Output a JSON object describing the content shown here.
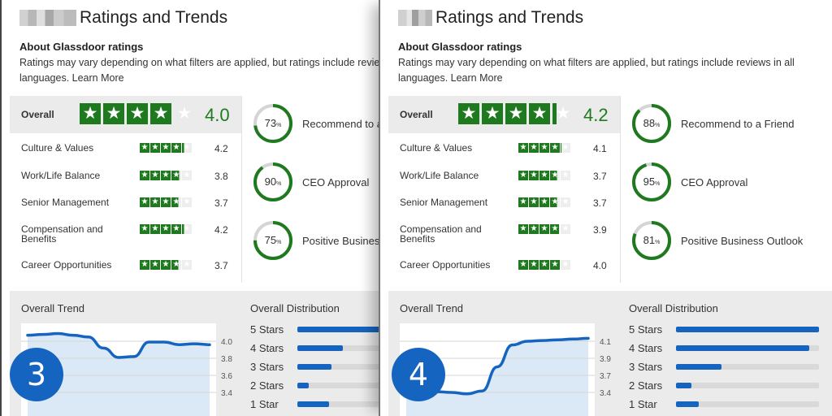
{
  "panels": [
    {
      "id": "left",
      "title": "Ratings and Trends",
      "about_title": "About Glassdoor ratings",
      "about_text": "Ratings may vary depending on what filters are applied, but ratings include reviews in all languages.",
      "learn_more": "Learn More",
      "overall": {
        "label": "Overall",
        "value": "4.0",
        "stars": 4.0
      },
      "subratings": [
        {
          "label": "Culture & Values",
          "value": "4.2",
          "stars": 4.2
        },
        {
          "label": "Work/Life Balance",
          "value": "3.8",
          "stars": 3.8
        },
        {
          "label": "Senior Management",
          "value": "3.7",
          "stars": 3.7
        },
        {
          "label": "Compensation and Benefits",
          "value": "4.2",
          "stars": 4.2
        },
        {
          "label": "Career Opportunities",
          "value": "3.7",
          "stars": 3.7
        }
      ],
      "recommendations": [
        {
          "label": "Recommend to a Friend",
          "percent": 73
        },
        {
          "label": "CEO Approval",
          "percent": 90
        },
        {
          "label": "Positive Business Outlook",
          "percent": 75
        }
      ],
      "trend": {
        "title": "Overall Trend",
        "yticks": [
          "4.0",
          "3.8",
          "3.6",
          "3.4"
        ],
        "points": [
          4.07,
          4.08,
          4.09,
          4.07,
          4.05,
          3.92,
          3.81,
          3.82,
          3.99,
          3.99,
          3.96,
          3.97,
          3.96
        ]
      },
      "distribution": {
        "title": "Overall Distribution",
        "rows": [
          {
            "label": "5 Stars",
            "fraction": 1.0
          },
          {
            "label": "4 Stars",
            "fraction": 0.32
          },
          {
            "label": "3 Stars",
            "fraction": 0.24
          },
          {
            "label": "2 Stars",
            "fraction": 0.08
          },
          {
            "label": "1 Star",
            "fraction": 0.22
          }
        ]
      },
      "badge": "3"
    },
    {
      "id": "right",
      "title": "Ratings and Trends",
      "about_title": "About Glassdoor ratings",
      "about_text": "Ratings may vary depending on what filters are applied, but ratings include reviews in all languages.",
      "learn_more": "Learn More",
      "overall": {
        "label": "Overall",
        "value": "4.2",
        "stars": 4.2
      },
      "subratings": [
        {
          "label": "Culture & Values",
          "value": "4.1",
          "stars": 4.1
        },
        {
          "label": "Work/Life Balance",
          "value": "3.7",
          "stars": 3.7
        },
        {
          "label": "Senior Management",
          "value": "3.7",
          "stars": 3.7
        },
        {
          "label": "Compensation and Benefits",
          "value": "3.9",
          "stars": 3.9
        },
        {
          "label": "Career Opportunities",
          "value": "4.0",
          "stars": 4.0
        }
      ],
      "recommendations": [
        {
          "label": "Recommend to a Friend",
          "percent": 88
        },
        {
          "label": "CEO Approval",
          "percent": 95
        },
        {
          "label": "Positive Business Outlook",
          "percent": 81
        }
      ],
      "trend": {
        "title": "Overall Trend",
        "yticks": [
          "4.1",
          "3.9",
          "3.7",
          "3.4"
        ],
        "points": [
          3.45,
          3.43,
          3.41,
          3.4,
          3.38,
          3.42,
          3.75,
          4.05,
          4.1,
          4.11,
          4.12,
          4.13,
          4.14
        ]
      },
      "distribution": {
        "title": "Overall Distribution",
        "rows": [
          {
            "label": "5 Stars",
            "fraction": 1.0
          },
          {
            "label": "4 Stars",
            "fraction": 0.93
          },
          {
            "label": "3 Stars",
            "fraction": 0.32
          },
          {
            "label": "2 Stars",
            "fraction": 0.11
          },
          {
            "label": "1 Star",
            "fraction": 0.16
          }
        ]
      },
      "badge": "4"
    }
  ],
  "colors": {
    "star_green": "#1f7a1f",
    "bar_blue": "#1565c0",
    "donut_track": "#d5d5d5"
  }
}
